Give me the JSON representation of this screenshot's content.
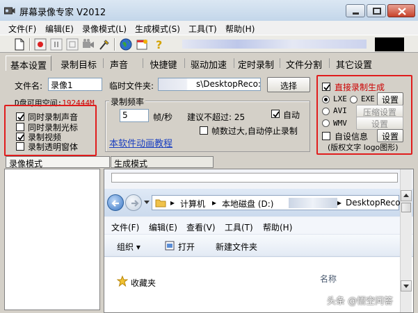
{
  "window": {
    "title": "屏幕录像专家 V2012"
  },
  "menu": [
    "文件(F)",
    "编辑(E)",
    "录像模式(L)",
    "生成模式(S)",
    "工具(T)",
    "帮助(H)"
  ],
  "tabs": [
    "基本设置",
    "录制目标",
    "声音",
    "快捷键",
    "驱动加速",
    "定时录制",
    "文件分割",
    "其它设置"
  ],
  "basic": {
    "filename_label": "文件名:",
    "filename_value": "录像1",
    "tempdir_label": "临时文件夹:",
    "tempdir_value": "s\\DesktopReco:",
    "select_button": "选择",
    "disk_free_label": "D盘可用空间:",
    "disk_free_value": "192444M"
  },
  "record_options": [
    {
      "label": "同时录制声音",
      "checked": true
    },
    {
      "label": "同时录制光标",
      "checked": false
    },
    {
      "label": "录制视频",
      "checked": true
    },
    {
      "label": "录制透明窗体",
      "checked": false
    }
  ],
  "frame_rate": {
    "group_title": "录制频率",
    "value": "5",
    "unit": "帧/秒",
    "suggest": "建议不超过: 25",
    "auto_label": "自动",
    "auto_checked": true,
    "stop_label": "帧数过大,自动停止录制",
    "stop_checked": false,
    "tutorial_link": "本软件动画教程"
  },
  "output": {
    "direct_label": "直接录制生成",
    "direct_checked": true,
    "lxe": "LXE",
    "exe": "EXE",
    "settings_btn": "设置",
    "avi": "AVI",
    "compress_btn": "压缩设置",
    "wmv": "WMV",
    "wmv_settings_btn": "设置",
    "selected": "LXE",
    "custom_info_label": "自设信息",
    "custom_info_checked": false,
    "custom_info_btn": "设置",
    "copyright_note": "(版权文字 logo图形)"
  },
  "lower_tabs": [
    "录像模式",
    "生成模式"
  ],
  "explorer": {
    "breadcrumb": [
      "计算机",
      "本地磁盘 (D:)",
      "DesktopReco"
    ],
    "menu": [
      "文件(F)",
      "编辑(E)",
      "查看(V)",
      "工具(T)",
      "帮助(H)"
    ],
    "commands": [
      "组织 ▾",
      "打开",
      "新建文件夹"
    ],
    "list_item": "收藏夹",
    "column_header": "名称"
  },
  "watermark": "头条 @悟空问答"
}
